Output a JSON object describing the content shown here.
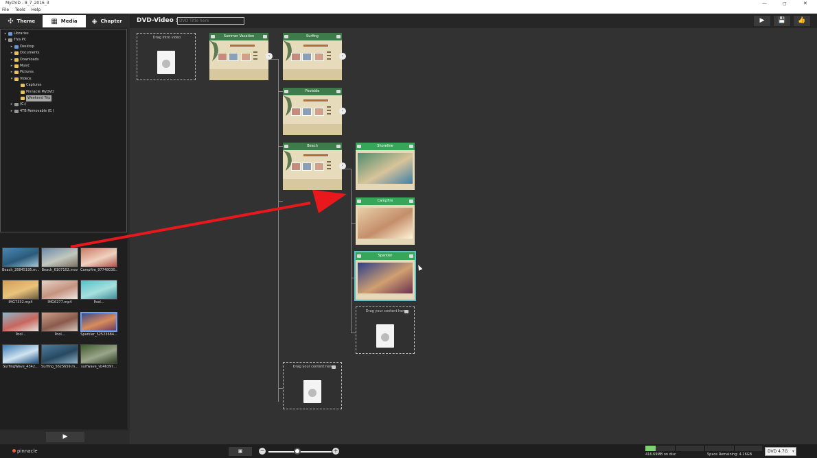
{
  "window": {
    "title": "MyDVD - 8_7_2016_3"
  },
  "menu": [
    "File",
    "Tools",
    "Help"
  ],
  "left_tabs": [
    {
      "label": "Theme",
      "icon": "theme-icon"
    },
    {
      "label": "Media",
      "icon": "media-icon"
    },
    {
      "label": "Chapter",
      "icon": "chapter-icon"
    }
  ],
  "tree": [
    {
      "label": "Libraries",
      "indent": 0,
      "expanded": false,
      "kind": "folder-blue"
    },
    {
      "label": "This PC",
      "indent": 0,
      "expanded": true,
      "kind": "pc"
    },
    {
      "label": "Desktop",
      "indent": 1,
      "expanded": false,
      "kind": "folder-blue"
    },
    {
      "label": "Documents",
      "indent": 1,
      "expanded": false,
      "kind": "folder"
    },
    {
      "label": "Downloads",
      "indent": 1,
      "expanded": false,
      "kind": "folder"
    },
    {
      "label": "Music",
      "indent": 1,
      "expanded": false,
      "kind": "folder"
    },
    {
      "label": "Pictures",
      "indent": 1,
      "expanded": false,
      "kind": "folder"
    },
    {
      "label": "Videos",
      "indent": 1,
      "expanded": true,
      "kind": "folder"
    },
    {
      "label": "Captures",
      "indent": 2,
      "kind": "folder"
    },
    {
      "label": "Pinnacle MyDVD",
      "indent": 2,
      "kind": "folder"
    },
    {
      "label": "Weekend Trip",
      "indent": 2,
      "kind": "folder",
      "selected": true
    },
    {
      "label": "(C:)",
      "indent": 1,
      "expanded": false,
      "kind": "drive"
    },
    {
      "label": "4TB Removable (E:)",
      "indent": 1,
      "expanded": false,
      "kind": "drive"
    }
  ],
  "media": [
    {
      "name": "Beach_28845195.m...",
      "colors": [
        "#4a86b5",
        "#2b5a7a",
        "#a8c8d8"
      ]
    },
    {
      "name": "Beach_6107102.mov",
      "colors": [
        "#6a8aa8",
        "#c3c8bf",
        "#7a7060"
      ]
    },
    {
      "name": "Campfire_97748030...",
      "colors": [
        "#c97b63",
        "#f0d2c0",
        "#aa5547"
      ]
    },
    {
      "name": "IMG7332.mp4",
      "colors": [
        "#d39e5a",
        "#e9c37c",
        "#6a5a3c"
      ]
    },
    {
      "name": "IMG6277.mp4",
      "colors": [
        "#e6d2c6",
        "#c59380",
        "#f0e6e0"
      ]
    },
    {
      "name": "Pool...",
      "colors": [
        "#58c0c8",
        "#a6e0de",
        "#3d8d9a"
      ]
    },
    {
      "name": "Pool...",
      "colors": [
        "#8eb7c8",
        "#c8665d",
        "#e6e0da"
      ]
    },
    {
      "name": "Pool...",
      "colors": [
        "#caa08a",
        "#8a5a4c",
        "#d8c8be"
      ]
    },
    {
      "name": "Sparkler_52523684...",
      "colors": [
        "#3a4a8a",
        "#d88c5c",
        "#6a3a5c"
      ],
      "selected": true
    },
    {
      "name": "SurfingWave_4342...",
      "colors": [
        "#3778b3",
        "#d0e4f0",
        "#1d4d80"
      ]
    },
    {
      "name": "Surfing_5625659.m...",
      "colors": [
        "#4e7ea0",
        "#27485f",
        "#8fb2c8"
      ]
    },
    {
      "name": "surfwave_vb46397...",
      "colors": [
        "#3e5c2c",
        "#9aa58a",
        "#2a3a20"
      ]
    }
  ],
  "header": {
    "dvd_label": "DVD-Video :",
    "title_placeholder": "DVD Title here"
  },
  "header_buttons": [
    {
      "icon": "play-icon",
      "glyph": "▶"
    },
    {
      "icon": "save-icon",
      "glyph": "💾"
    },
    {
      "icon": "like-icon",
      "glyph": "👍"
    }
  ],
  "canvas": {
    "intro_drop": {
      "label": "Drag intro video"
    },
    "main_menu": {
      "label": "Summer Vacation"
    },
    "submenus": [
      {
        "label": "Surfing"
      },
      {
        "label": "Poolside"
      },
      {
        "label": "Beach"
      }
    ],
    "chapters": [
      {
        "label": "Shoreline",
        "colors": [
          "#4f8c6c",
          "#d8c49a",
          "#3d7fa8"
        ]
      },
      {
        "label": "Campfire",
        "colors": [
          "#e8cfa8",
          "#c48e6a",
          "#fff5d8"
        ]
      },
      {
        "label": "Sparkler",
        "colors": [
          "#2c3f8a",
          "#d0a070",
          "#6a3050"
        ],
        "selected": true
      }
    ],
    "drop_chapter": {
      "label": "Drag your content here"
    },
    "drop_submenu": {
      "label": "Drag your content here"
    }
  },
  "footer": {
    "brand": "pinnacle",
    "disc_used": "416.69MB on disc",
    "space_remaining": "Space Remaining: 4.26GB",
    "disc_type": "DVD 4.7G",
    "disc_fill_fraction": 0.088,
    "zoom_fraction": 0.46
  },
  "colors": {
    "accent": "#3f7a4b",
    "accent_bright": "#37a65a",
    "selection": "#5ec2c8",
    "arrow": "#e8181c"
  }
}
